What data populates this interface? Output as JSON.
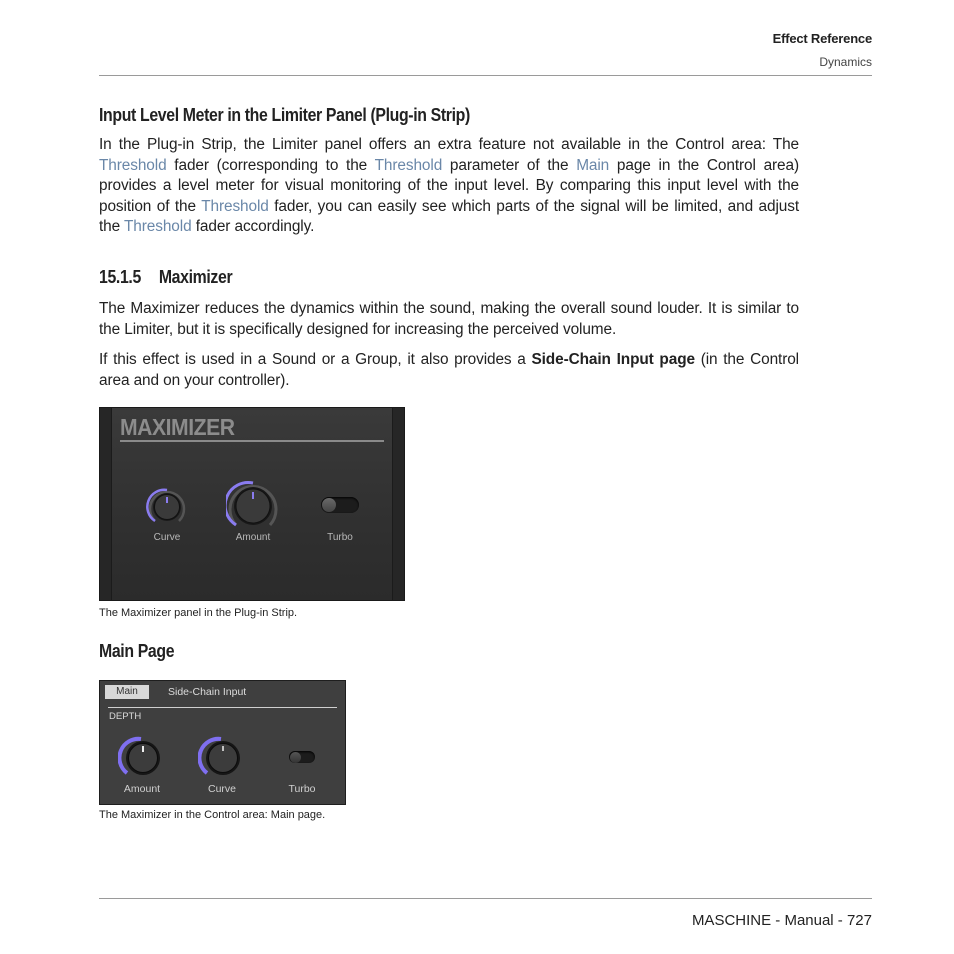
{
  "header": {
    "chapter": "Effect Reference",
    "section": "Dynamics"
  },
  "section1": {
    "heading": "Input Level Meter in the Limiter Panel (Plug-in Strip)",
    "paragraph": [
      {
        "t": "In the Plug-in Strip, the Limiter panel offers an extra feature not available in the Control area: The "
      },
      {
        "t": "Threshold",
        "link": true
      },
      {
        "t": " fader (corresponding to the "
      },
      {
        "t": "Threshold",
        "link": true
      },
      {
        "t": " parameter of the "
      },
      {
        "t": "Main",
        "link": true
      },
      {
        "t": " page in the Control area) provides a level meter for visual monitoring of the input level. By comparing this input level with the position of the "
      },
      {
        "t": "Threshold",
        "link": true
      },
      {
        "t": " fader, you can easily see which parts of the signal will be limited, and adjust the "
      },
      {
        "t": "Threshold",
        "link": true
      },
      {
        "t": " fader accordingly."
      }
    ]
  },
  "section2": {
    "number": "15.1.5",
    "heading": "Maximizer",
    "paragraph1": "The Maximizer reduces the dynamics within the sound, making the overall sound louder. It is similar to the Limiter, but it is specifically designed for increasing the perceived volume.",
    "paragraph2_before": "If this effect is used in a Sound or a Group, it also provides a ",
    "paragraph2_bold": "Side-Chain Input page",
    "paragraph2_after": " (in the Control area and on your controller)."
  },
  "plugin_panel": {
    "title": "MAXIMIZER",
    "accent_color": "#8a7cf0",
    "controls": [
      {
        "label": "Curve",
        "type": "knob",
        "value_fraction": 0.5
      },
      {
        "label": "Amount",
        "type": "knob",
        "value_fraction": 0.5
      },
      {
        "label": "Turbo",
        "type": "toggle",
        "on": false
      }
    ],
    "caption": "The Maximizer panel in the Plug-in Strip."
  },
  "main_page": {
    "heading": "Main Page",
    "tabs": [
      {
        "label": "Main",
        "active": true
      },
      {
        "label": "Side-Chain Input",
        "active": false
      }
    ],
    "group_label": "DEPTH",
    "controls": [
      {
        "label": "Amount",
        "type": "knob",
        "value_fraction": 0.5
      },
      {
        "label": "Curve",
        "type": "knob",
        "value_fraction": 0.5
      },
      {
        "label": "Turbo",
        "type": "toggle",
        "on": false
      }
    ],
    "caption": "The Maximizer in the Control area: Main page."
  },
  "footer": {
    "text": "MASCHINE - Manual - 727"
  }
}
